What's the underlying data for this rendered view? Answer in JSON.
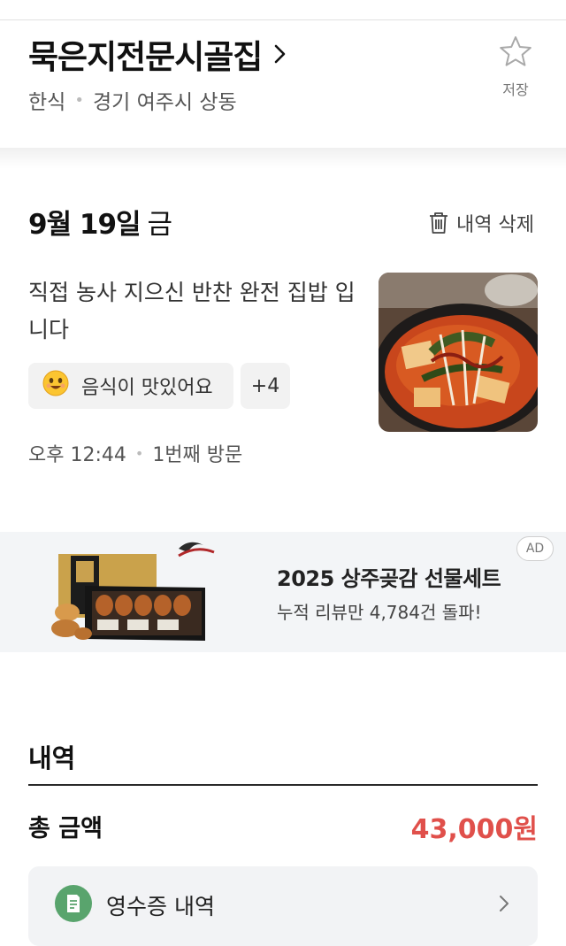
{
  "place": {
    "name": "묵은지전문시골집",
    "category": "한식",
    "location": "경기 여주시 상동",
    "save_label": "저장"
  },
  "visit": {
    "date": "9월 19일",
    "weekday": "금",
    "delete_label": "내역 삭제",
    "review_text": "직접 농사 지으신 반찬 완전 집밥 입니다",
    "keyword_label": "음식이 맛있어요",
    "more_keywords": "+4",
    "time": "오후 12:44",
    "visit_count": "1번째 방문"
  },
  "ad": {
    "badge": "AD",
    "title": "2025 상주곶감 선물세트",
    "subtitle": "누적 리뷰만 4,784건 돌파!"
  },
  "history": {
    "section_title": "내역",
    "total_label": "총 금액",
    "total_amount": "43,000원",
    "receipt_label": "영수증 내역"
  },
  "colors": {
    "accent_red": "#e0504b",
    "receipt_icon_green": "#59a46d"
  },
  "icons": [
    "chevron-right-icon",
    "star-outline-icon",
    "trash-icon",
    "smiley-icon",
    "receipt-icon"
  ]
}
